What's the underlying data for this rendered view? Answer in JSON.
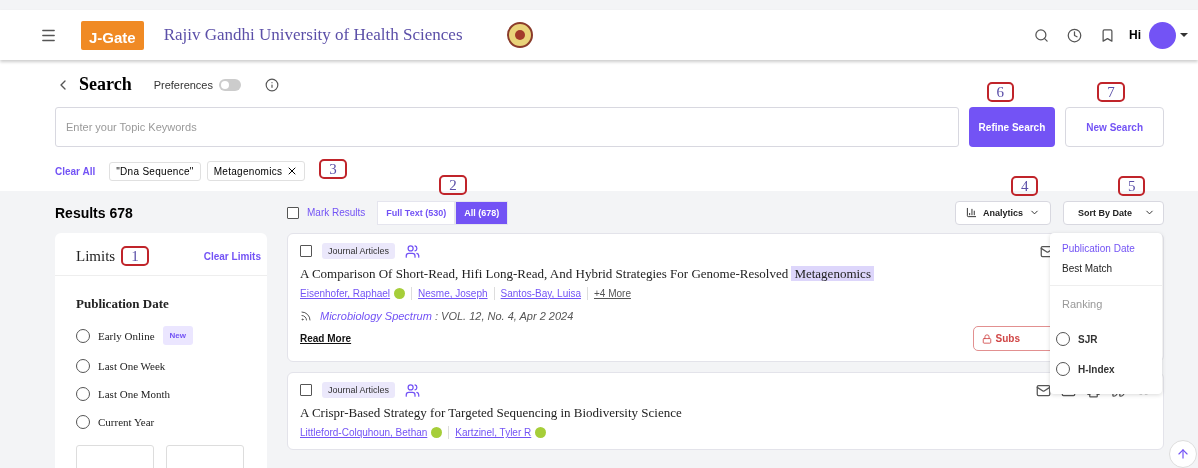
{
  "header": {
    "logo_text": "J-Gate",
    "university": "Rajiv Gandhi University of Health Sciences",
    "greeting": "Hi"
  },
  "search": {
    "title": "Search",
    "preferences": {
      "label": "Preferences",
      "on": false
    },
    "placeholder": "Enter your Topic Keywords",
    "refine_button": "Refine Search",
    "new_button": "New Search",
    "clear_all": "Clear All",
    "chips": [
      {
        "label": "\"Dna Sequence\"",
        "removable": false
      },
      {
        "label": "Metagenomics",
        "removable": true
      }
    ]
  },
  "results": {
    "count_label": "Results 678",
    "mark_results": {
      "label": "Mark Results",
      "checked": false
    },
    "tabs": [
      {
        "label": "Full Text (530)",
        "selected": false
      },
      {
        "label": "All (678)",
        "selected": true
      }
    ],
    "analytics": "Analytics",
    "sort": "Sort By Date"
  },
  "sort_menu": {
    "items": [
      {
        "label": "Publication Date",
        "selected": true
      },
      {
        "label": "Best Match",
        "selected": false
      }
    ],
    "section": "Ranking",
    "ranking": [
      {
        "label": "SJR",
        "selected": false
      },
      {
        "label": "H-Index",
        "selected": false
      }
    ]
  },
  "limits": {
    "title": "Limits",
    "clear": "Clear Limits",
    "section": "Publication Date",
    "options": [
      {
        "label": "Early Online",
        "badge": "New",
        "selected": false
      },
      {
        "label": "Last One Week",
        "selected": false
      },
      {
        "label": "Last One Month",
        "selected": false
      },
      {
        "label": "Current Year",
        "selected": false
      }
    ]
  },
  "articles": [
    {
      "checked": false,
      "type": "Journal Articles",
      "title": "A Comparison Of Short-Read, Hifi Long-Read, And Hybrid Strategies For Genome-Resolved",
      "highlight": "Metagenomics",
      "authors": [
        {
          "name": "Eisenhofer, Raphael",
          "orcid": true
        },
        {
          "name": "Nesme, Joseph",
          "orcid": false
        },
        {
          "name": "Santos-Bay, Luisa",
          "orcid": false
        }
      ],
      "more": "+4 More",
      "journal": "Microbiology Spectrum",
      "issue": " : VOL. 12, No. 4, Apr 2 2024",
      "read_more": "Read More",
      "subscribe": "Subs",
      "covered_by_menu": true
    },
    {
      "checked": false,
      "type": "Journal Articles",
      "title": "A Crispr-Based Strategy for Targeted Sequencing in Biodiversity Science",
      "authors": [
        {
          "name": "Littleford-Colquhoun, Bethan",
          "orcid": true
        },
        {
          "name": "Kartzinel, Tyler R",
          "orcid": true
        }
      ],
      "covered_by_menu": false
    }
  ],
  "callouts": [
    "1",
    "2",
    "3",
    "4",
    "5",
    "6",
    "7"
  ]
}
